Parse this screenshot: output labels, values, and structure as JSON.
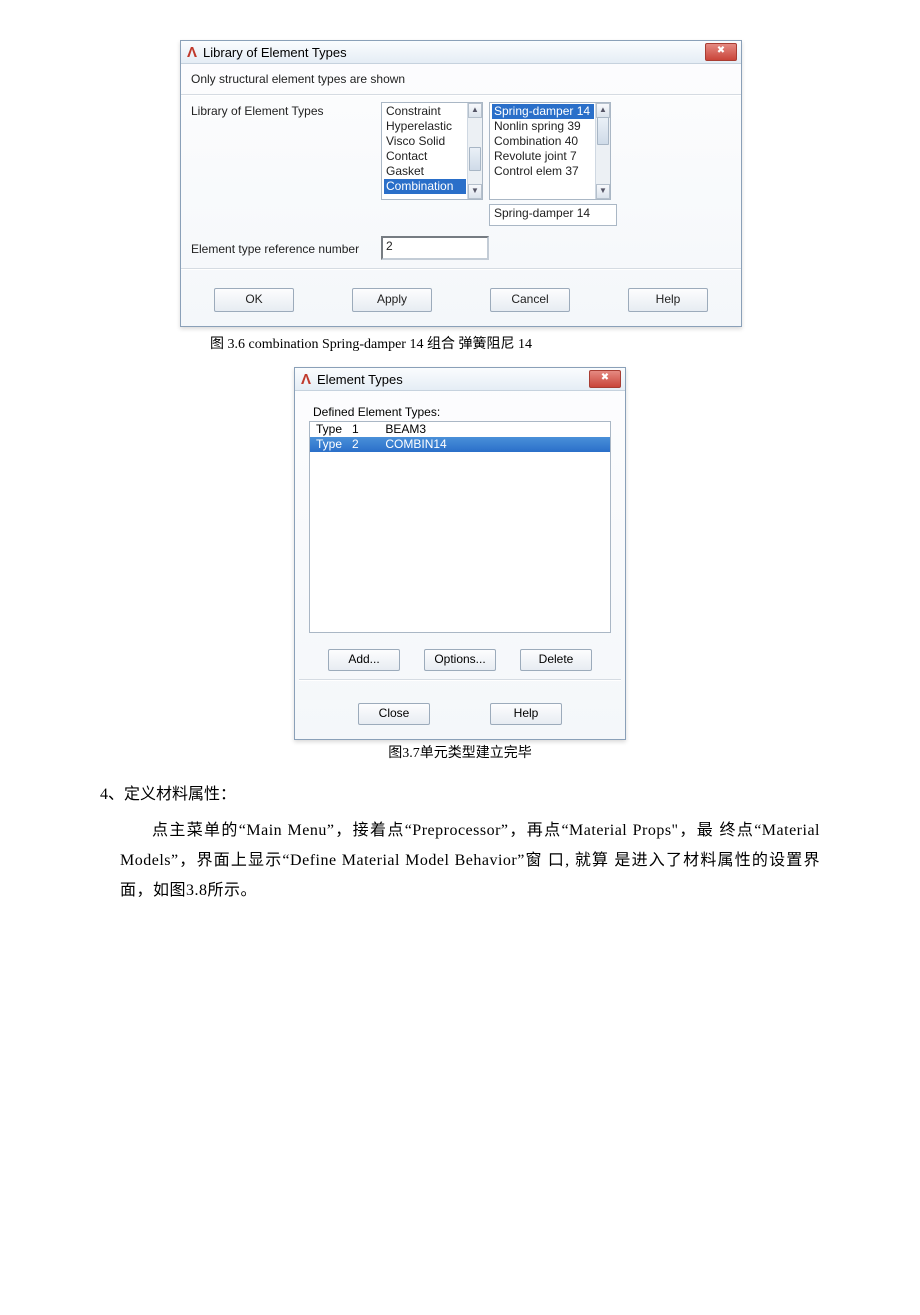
{
  "dialog1": {
    "title": "Library of Element Types",
    "info": "Only structural element types are shown",
    "row_label": "Library of Element Types",
    "left_list": [
      "Constraint",
      "Hyperelastic",
      "Visco Solid",
      "Contact",
      "Gasket",
      "Combination"
    ],
    "right_list": [
      "Spring-damper 14",
      "Nonlin spring 39",
      "Combination  40",
      "Revolute joint 7",
      "Control elem  37"
    ],
    "readonly": "Spring-damper 14",
    "ref_label": "Element type reference number",
    "ref_value": "2",
    "buttons": [
      "OK",
      "Apply",
      "Cancel",
      "Help"
    ]
  },
  "caption1": "图  3.6 combination Spring-damper 14 组合  弹簧阻尼  14",
  "dialog2": {
    "title": "Element Types",
    "defined_label": "Defined Element Types:",
    "rows": [
      "Type   1        BEAM3",
      "Type   2        COMBIN14"
    ],
    "btns_mid": [
      "Add...",
      "Options...",
      "Delete"
    ],
    "btns_bot": [
      "Close",
      "Help"
    ]
  },
  "caption2": "图3.7单元类型建立完毕",
  "section": "4、定义材料属性：",
  "para": "点主菜单的“Main    Menu”，接着点“Preprocessor”，再点“Material    Props\"，最 终点“Material  Models”，界面上显示“Define  Material  Model  Behavior”窗    口, 就算 是进入了材料属性的设置界面，如图3.8所示。"
}
